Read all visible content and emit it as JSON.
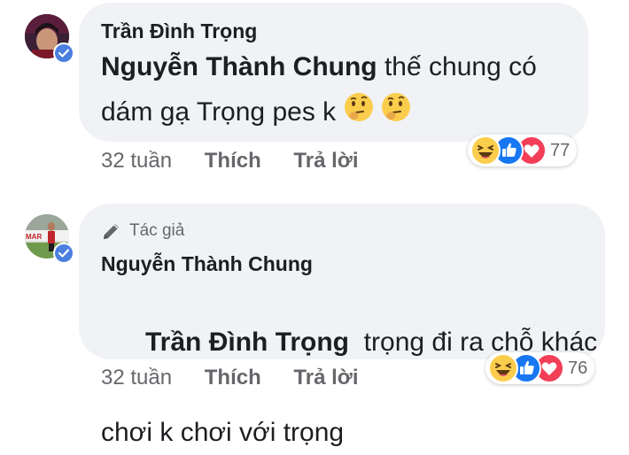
{
  "comments": [
    {
      "author": "Trần Đình Trọng",
      "mention": "Nguyễn Thành Chung",
      "text_line1": " thế chung có",
      "text_line2": "dám gạ Trọng pes k ",
      "time": "32 tuần",
      "like_label": "Thích",
      "reply_label": "Trả lời",
      "reaction_count": "77",
      "reactions": [
        "haha-icon",
        "like-icon",
        "love-icon"
      ],
      "inline_emoji": [
        "thinking-face-icon",
        "thinking-face-icon"
      ]
    },
    {
      "badge": "Tác giả",
      "badge_icon": "pencil-icon",
      "author": "Nguyễn Thành Chung",
      "mention": "Trần Đình Trọng",
      "text_line1": "  trọng đi ra chỗ khác",
      "text_line2": "chơi k chơi với trọng",
      "time": "32 tuần",
      "like_label": "Thích",
      "reply_label": "Trả lời",
      "reaction_count": "76",
      "reactions": [
        "haha-icon",
        "like-icon",
        "love-icon"
      ]
    }
  ],
  "colors": {
    "bubble": "#f0f2f5",
    "meta_text": "#65676b",
    "text": "#1c1e21",
    "like_blue": "#1877f2",
    "love_red": "#f33e58",
    "haha_yellow": "#fbcd4c",
    "verified_blue": "#4a7fe0"
  }
}
